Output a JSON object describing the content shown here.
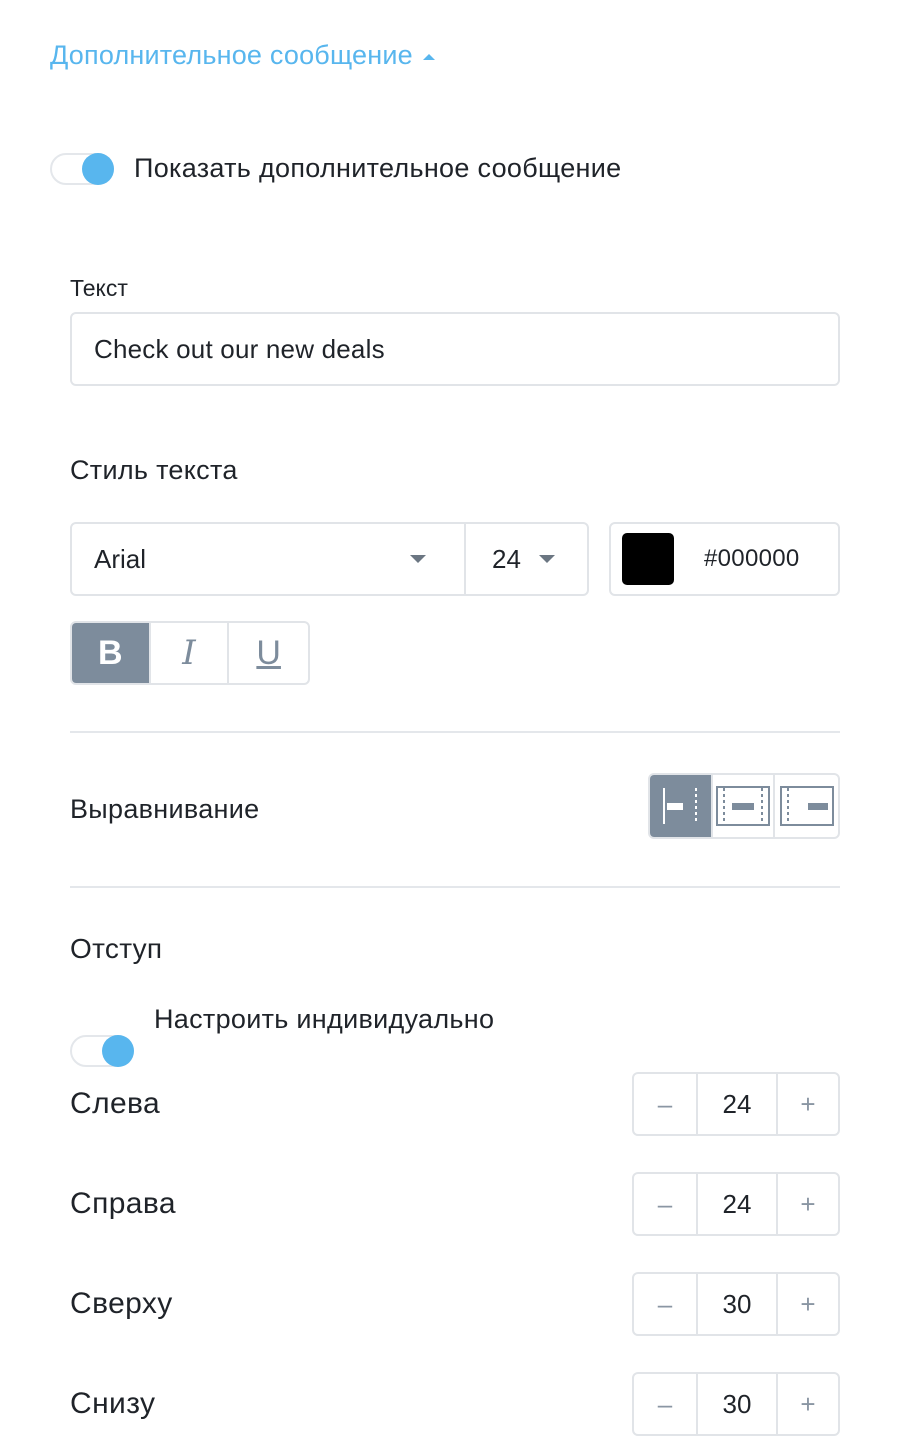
{
  "section": {
    "title": "Дополнительное сообщение"
  },
  "show_message": {
    "label": "Показать дополнительное сообщение",
    "enabled": true
  },
  "text_field": {
    "label": "Текст",
    "value": "Check out our new deals"
  },
  "text_style": {
    "label": "Стиль текста",
    "font": "Arial",
    "size": "24",
    "color_hex": "#000000",
    "bold_label": "B",
    "italic_label": "I",
    "underline_label": "U",
    "active_style": "bold"
  },
  "alignment": {
    "label": "Выравнивание",
    "options": [
      "left-align-icon",
      "center-align-icon",
      "right-align-icon"
    ],
    "selected": "left"
  },
  "padding": {
    "label": "Отступ",
    "individual": {
      "label": "Настроить индивидуально",
      "enabled": true
    },
    "minus": "–",
    "plus": "+",
    "left": {
      "label": "Слева",
      "value": "24"
    },
    "right": {
      "label": "Справа",
      "value": "24"
    },
    "top": {
      "label": "Сверху",
      "value": "30"
    },
    "bottom": {
      "label": "Снизу",
      "value": "30"
    }
  },
  "colors": {
    "accent": "#58b6ee",
    "active_button": "#7d8c9c",
    "border": "#e1e4e8"
  }
}
